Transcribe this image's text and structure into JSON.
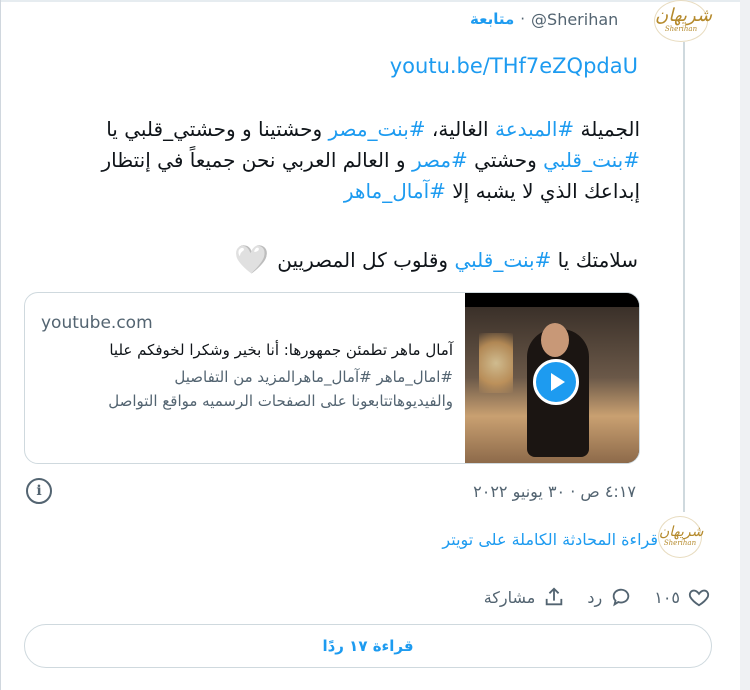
{
  "header": {
    "follow": "متابعة",
    "dot": "·",
    "handle": "@Sherihan",
    "avatar_logo": "Sherihan"
  },
  "tweet": {
    "url": "youtu.be/THf7eZQpdaU",
    "text_segments": [
      {
        "t": "الجميلة ",
        "h": false
      },
      {
        "t": "#المبدعة",
        "h": true
      },
      {
        "t": " الغالية، ",
        "h": false
      },
      {
        "t": "#بنت_مصر",
        "h": true
      },
      {
        "t": " وحشتينا و وحشتي_قلبي يا ",
        "h": false
      },
      {
        "t": "#بنت_قلبي",
        "h": true
      },
      {
        "t": " وحشتي ",
        "h": false
      },
      {
        "t": "#مصر",
        "h": true
      },
      {
        "t": " و العالم العربي نحن جميعاً في إنتظار إبداعك الذي لا يشبه إلا ",
        "h": false
      },
      {
        "t": "#آمال_ماهر",
        "h": true
      }
    ],
    "line2_pre": "سلامتك يا ",
    "line2_hash": "#بنت_قلبي",
    "line2_post": " وقلوب كل المصريين",
    "heart": "🤍"
  },
  "card": {
    "domain": "youtube.com",
    "title": "آمال ماهر تطمئن جمهورها: أنا بخير وشكرا لخوفكم عليا",
    "desc_hash1": "#امال_ماهر",
    "desc_hash2": "#آمال_ماهر",
    "desc_rest1": "المزيد من التفاصيل",
    "desc_line2": "والفيديوهاتتابعونا على الصفحات الرسميه مواقع التواصل"
  },
  "meta": {
    "time": "٤:١٧ ص · ٣٠ يونيو ٢٠٢٢",
    "info": "i"
  },
  "footer": {
    "read_full": "قراءة المحادثة الكاملة على تويتر",
    "likes": "١٠٥",
    "reply": "رد",
    "share": "مشاركة",
    "read_replies": "قراءة ١٧ ردًا"
  }
}
